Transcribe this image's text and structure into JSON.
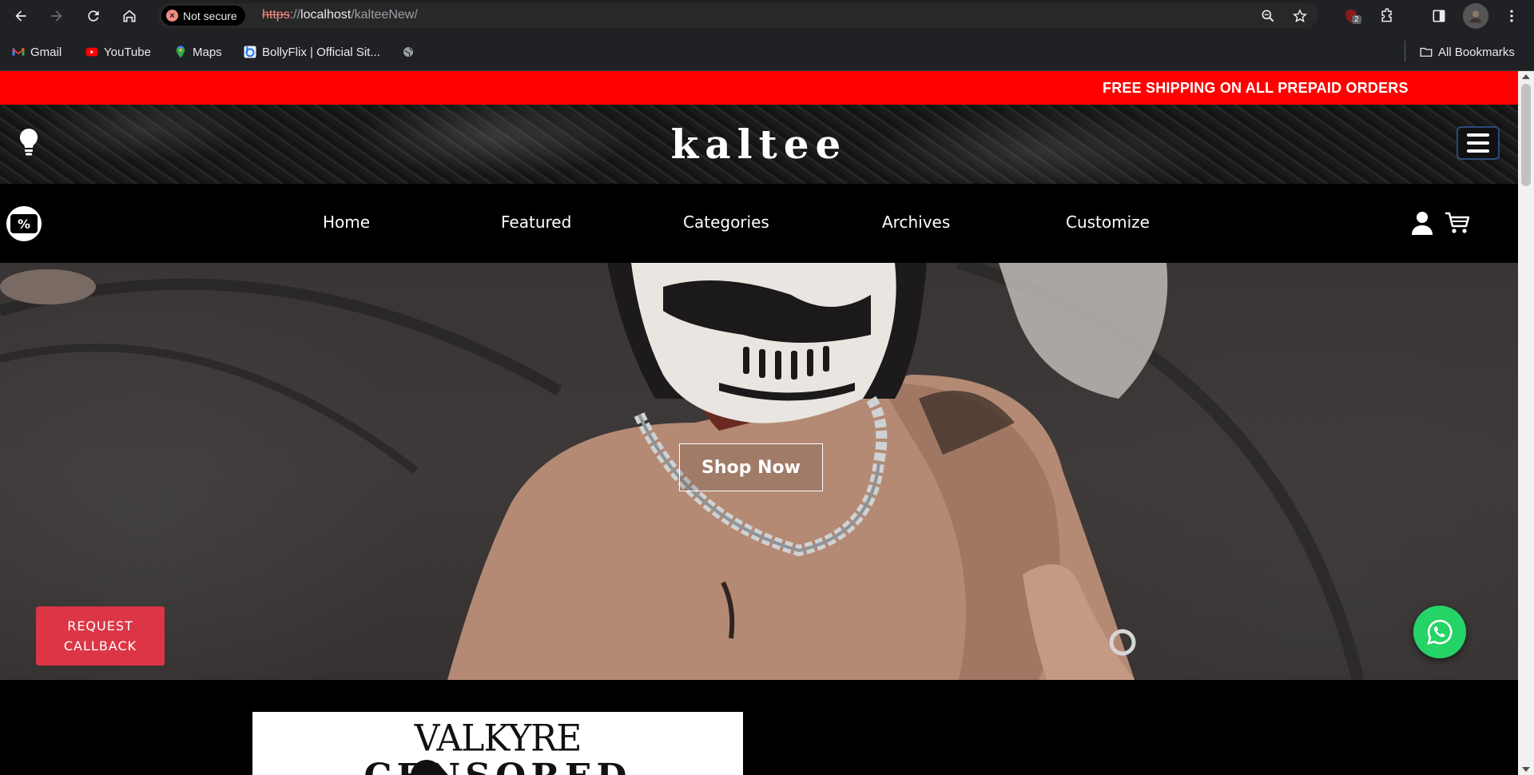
{
  "browser": {
    "security_label": "Not secure",
    "url_scheme": "https",
    "url_rest": "://",
    "url_host": "localhost",
    "url_path": "/kalteeNew/",
    "extension_badge": "2",
    "bookmarks": [
      {
        "label": "Gmail",
        "icon": "gmail-icon"
      },
      {
        "label": "YouTube",
        "icon": "youtube-icon"
      },
      {
        "label": "Maps",
        "icon": "maps-icon"
      },
      {
        "label": "BollyFlix | Official Sit...",
        "icon": "bollyflix-icon"
      }
    ],
    "all_bookmarks_label": "All Bookmarks"
  },
  "site": {
    "announcement": "FREE SHIPPING ON ALL PREPAID ORDERS",
    "logo": "kaltee",
    "discount_badge": "%",
    "nav": [
      "Home",
      "Featured",
      "Categories",
      "Archives",
      "Customize"
    ],
    "hero_button": "Shop Now",
    "poster_title": "VALKYRE",
    "poster_subtitle": "CENSORED",
    "callback_line1": "REQUEST",
    "callback_line2": "CALLBACK"
  },
  "colors": {
    "announcement_bg": "#ff0000",
    "callback_bg": "#dc3545",
    "whatsapp_bg": "#25d366",
    "chrome_bg": "#202124"
  }
}
